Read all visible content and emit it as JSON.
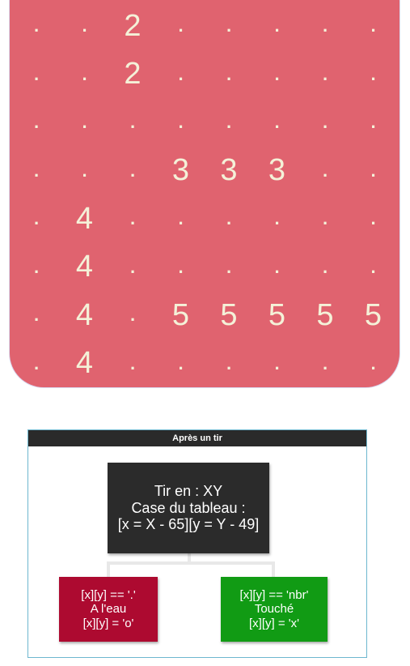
{
  "board": {
    "background": "#e0636f",
    "text_color": "#f4f1d8",
    "rows": [
      [
        ".",
        ".",
        "2",
        ".",
        ".",
        ".",
        ".",
        "."
      ],
      [
        ".",
        ".",
        "2",
        ".",
        ".",
        ".",
        ".",
        "."
      ],
      [
        ".",
        ".",
        ".",
        ".",
        ".",
        ".",
        ".",
        "."
      ],
      [
        ".",
        ".",
        ".",
        "3",
        "3",
        "3",
        ".",
        "."
      ],
      [
        ".",
        "4",
        ".",
        ".",
        ".",
        ".",
        ".",
        "."
      ],
      [
        ".",
        "4",
        ".",
        ".",
        ".",
        ".",
        ".",
        "."
      ],
      [
        ".",
        "4",
        ".",
        "5",
        "5",
        "5",
        "5",
        "5"
      ],
      [
        ".",
        "4",
        ".",
        ".",
        ".",
        ".",
        ".",
        "."
      ]
    ]
  },
  "diagram": {
    "title": "Après un tir",
    "root": {
      "lines": [
        "Tir en : XY",
        "Case du tableau :",
        "[x = X - 65][y = Y - 49]"
      ],
      "color": "#2b2b2b"
    },
    "left": {
      "lines": [
        "[x][y] == '.'",
        "A l'eau",
        "[x][y] = 'o'"
      ],
      "color": "#ad0a30"
    },
    "right": {
      "lines": [
        "[x][y] == 'nbr'",
        "Touché",
        "[x][y] = 'x'"
      ],
      "color": "#119b14"
    }
  }
}
